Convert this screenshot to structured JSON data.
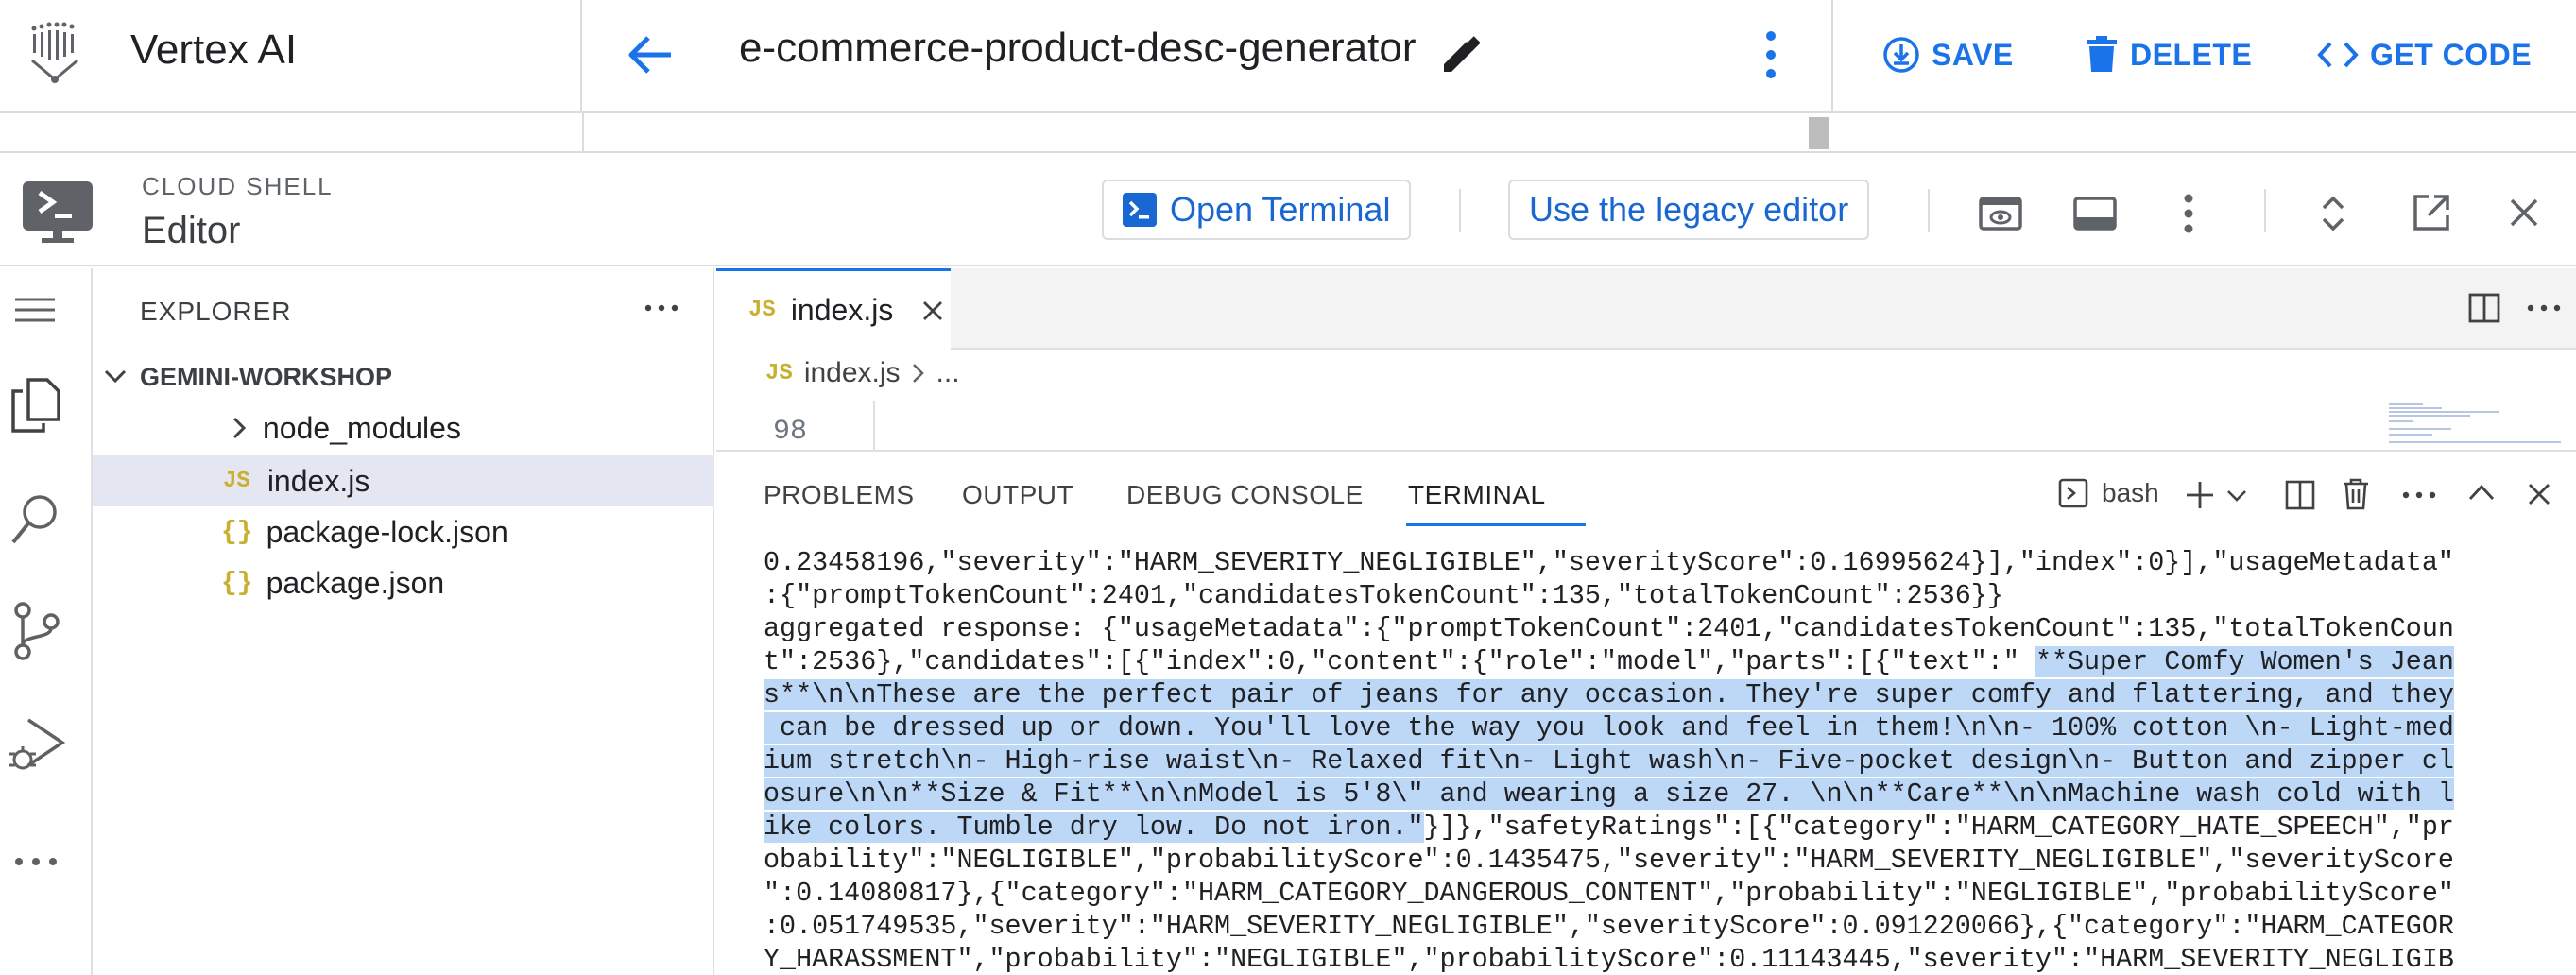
{
  "topbar": {
    "app_title": "Vertex AI",
    "prompt_title": "e-commerce-product-desc-generator",
    "save_label": "SAVE",
    "delete_label": "DELETE",
    "get_code_label": "GET CODE"
  },
  "cloud_shell": {
    "label": "CLOUD SHELL",
    "title": "Editor",
    "open_terminal_label": "Open Terminal",
    "legacy_editor_label": "Use the legacy editor"
  },
  "explorer": {
    "title": "EXPLORER",
    "workspace": "GEMINI-WORKSHOP",
    "items": [
      {
        "label": "node_modules",
        "kind": "folder"
      },
      {
        "label": "index.js",
        "kind": "js"
      },
      {
        "label": "package-lock.json",
        "kind": "json"
      },
      {
        "label": "package.json",
        "kind": "json"
      }
    ]
  },
  "editor": {
    "tab_label": "index.js",
    "tab_badge": "JS",
    "breadcrumb_file": "index.js",
    "breadcrumb_rest": "...",
    "line_number": "98"
  },
  "panel": {
    "tabs": [
      "PROBLEMS",
      "OUTPUT",
      "DEBUG CONSOLE",
      "TERMINAL"
    ],
    "active_tab": "TERMINAL",
    "shell_label": "bash"
  },
  "terminal": {
    "lines": [
      {
        "pre": "0.23458196,\"severity\":\"HARM_SEVERITY_NEGLIGIBLE\",\"severityScore\":0.16995624}],\"index\":0}],\"usageMetadata\"",
        "hl": "",
        "post": ""
      },
      {
        "pre": ":{\"promptTokenCount\":2401,\"candidatesTokenCount\":135,\"totalTokenCount\":2536}}",
        "hl": "",
        "post": ""
      },
      {
        "pre": "aggregated response: {\"usageMetadata\":{\"promptTokenCount\":2401,\"candidatesTokenCount\":135,\"totalTokenCoun",
        "hl": "",
        "post": ""
      },
      {
        "pre": "t\":2536},\"candidates\":[{\"index\":0,\"content\":{\"role\":\"model\",\"parts\":[{\"text\":\" ",
        "hl": "**Super Comfy Women's Jean",
        "post": ""
      },
      {
        "pre": "",
        "hl": "s**\\n\\nThese are the perfect pair of jeans for any occasion. They're super comfy and flattering, and they",
        "post": ""
      },
      {
        "pre": "",
        "hl": " can be dressed up or down. You'll love the way you look and feel in them!\\n\\n- 100% cotton \\n- Light-med",
        "post": ""
      },
      {
        "pre": "",
        "hl": "ium stretch\\n- High-rise waist\\n- Relaxed fit\\n- Light wash\\n- Five-pocket design\\n- Button and zipper cl",
        "post": ""
      },
      {
        "pre": "",
        "hl": "osure\\n\\n**Size & Fit**\\n\\nModel is 5'8\\\" and wearing a size 27. \\n\\n**Care**\\n\\nMachine wash cold with l",
        "post": ""
      },
      {
        "pre": "",
        "hl": "ike colors. Tumble dry low. Do not iron.\"",
        "post": "}]},\"safetyRatings\":[{\"category\":\"HARM_CATEGORY_HATE_SPEECH\",\"pr"
      },
      {
        "pre": "obability\":\"NEGLIGIBLE\",\"probabilityScore\":0.1435475,\"severity\":\"HARM_SEVERITY_NEGLIGIBLE\",\"severityScore",
        "hl": "",
        "post": ""
      },
      {
        "pre": "\":0.14080817},{\"category\":\"HARM_CATEGORY_DANGEROUS_CONTENT\",\"probability\":\"NEGLIGIBLE\",\"probabilityScore\"",
        "hl": "",
        "post": ""
      },
      {
        "pre": ":0.051749535,\"severity\":\"HARM_SEVERITY_NEGLIGIBLE\",\"severityScore\":0.091220066},{\"category\":\"HARM_CATEGOR",
        "hl": "",
        "post": ""
      },
      {
        "pre": "Y_HARASSMENT\",\"probability\":\"NEGLIGIBLE\",\"probabilityScore\":0.11143445,\"severity\":\"HARM_SEVERITY_NEGLIGIB",
        "hl": "",
        "post": ""
      }
    ]
  },
  "colors": {
    "accent": "#1a73e8",
    "selection": "#bdd7f6",
    "explorer_selected": "#e4e6f1",
    "js_badge": "#c9b030"
  },
  "icons": [
    "vertex-logo-icon",
    "back-arrow-icon",
    "edit-pencil-icon",
    "more-vert-icon",
    "save-icon",
    "delete-icon",
    "code-icon",
    "cloud-shell-icon",
    "terminal-icon",
    "preview-icon",
    "panel-icon",
    "expand-icon",
    "open-new-window-icon",
    "close-icon",
    "menu-icon",
    "files-icon",
    "search-icon",
    "source-control-icon",
    "run-debug-icon",
    "more-horiz-icon",
    "chevron-down-icon",
    "chevron-right-icon",
    "split-editor-icon",
    "add-icon",
    "trash-icon",
    "chevron-up-icon"
  ]
}
